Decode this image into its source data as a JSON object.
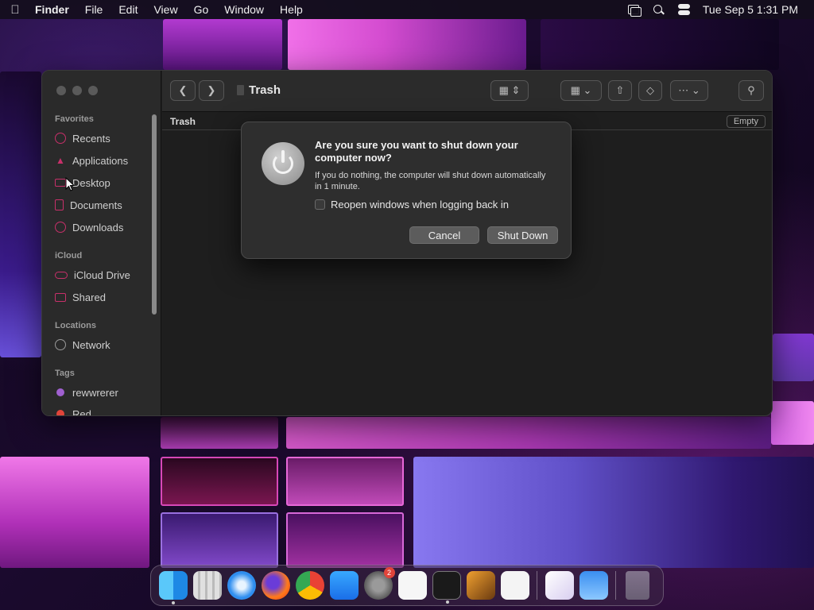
{
  "menubar": {
    "app_name": "Finder",
    "menus": [
      "File",
      "Edit",
      "View",
      "Go",
      "Window",
      "Help"
    ],
    "datetime": "Tue Sep 5  1:31 PM"
  },
  "finder": {
    "window_title": "Trash",
    "path_label": "Trash",
    "empty_button": "Empty",
    "sidebar": {
      "favorites_header": "Favorites",
      "favorites": [
        {
          "label": "Recents",
          "icon": "clock-icon"
        },
        {
          "label": "Applications",
          "icon": "applications-icon"
        },
        {
          "label": "Desktop",
          "icon": "desktop-icon"
        },
        {
          "label": "Documents",
          "icon": "document-icon"
        },
        {
          "label": "Downloads",
          "icon": "download-icon"
        }
      ],
      "icloud_header": "iCloud",
      "icloud": [
        {
          "label": "iCloud Drive",
          "icon": "cloud-icon"
        },
        {
          "label": "Shared",
          "icon": "shared-folder-icon"
        }
      ],
      "locations_header": "Locations",
      "locations": [
        {
          "label": "Network",
          "icon": "globe-icon"
        }
      ],
      "tags_header": "Tags",
      "tags": [
        {
          "label": "rewwrerer",
          "color": "#a060d0"
        },
        {
          "label": "Red",
          "color": "#e0443a"
        }
      ]
    }
  },
  "dialog": {
    "title": "Are you sure you want to shut down your computer now?",
    "message": "If you do nothing, the computer will shut down automatically in 1 minute.",
    "checkbox_label": "Reopen windows when logging back in",
    "checkbox_checked": false,
    "cancel_label": "Cancel",
    "confirm_label": "Shut Down"
  },
  "dock": {
    "apps": [
      {
        "name": "Finder",
        "running": true
      },
      {
        "name": "Launchpad"
      },
      {
        "name": "Safari"
      },
      {
        "name": "Firefox"
      },
      {
        "name": "Chrome"
      },
      {
        "name": "App Store"
      },
      {
        "name": "System Settings",
        "badge": "2"
      },
      {
        "name": "TextEdit"
      },
      {
        "name": "Terminal",
        "running": true
      },
      {
        "name": "GarageBand"
      },
      {
        "name": "Visual Studio Code"
      },
      {
        "name": "Visual Studio"
      },
      {
        "name": "Weather"
      },
      {
        "name": "Trash"
      }
    ]
  }
}
